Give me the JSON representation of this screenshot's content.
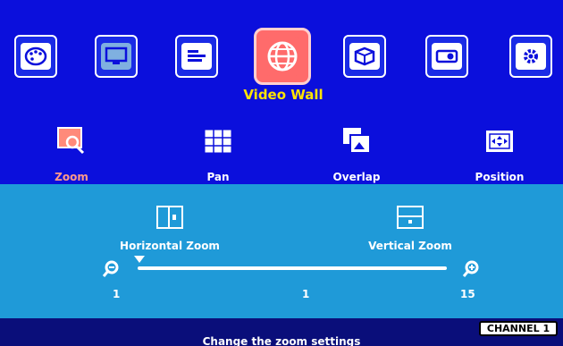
{
  "menu": {
    "items": [
      {
        "icon": "palette-icon",
        "active": false
      },
      {
        "icon": "monitor-icon",
        "active": false
      },
      {
        "icon": "bars-icon",
        "active": false
      },
      {
        "icon": "globe-icon",
        "active": true
      },
      {
        "icon": "cube-icon",
        "active": false
      },
      {
        "icon": "projector-icon",
        "active": false
      },
      {
        "icon": "gear-icon",
        "active": false
      }
    ],
    "active_title": "Video Wall"
  },
  "submenu": {
    "items": [
      {
        "label": "Zoom",
        "icon": "zoom-icon",
        "active": true
      },
      {
        "label": "Pan",
        "icon": "pan-grid-icon",
        "active": false
      },
      {
        "label": "Overlap",
        "icon": "overlap-icon",
        "active": false
      },
      {
        "label": "Position",
        "icon": "position-icon",
        "active": false
      }
    ]
  },
  "zoom_panel": {
    "horizontal_label": "Horizontal Zoom",
    "vertical_label": "Vertical Zoom",
    "slider": {
      "min": "1",
      "value": "1",
      "max": "15"
    }
  },
  "status": {
    "channel": "CHANNEL 1",
    "hint": "Change the zoom settings"
  },
  "colors": {
    "top_background": "#0b0fdc",
    "panel_background": "#1f9ad8",
    "title_text": "#ffe400",
    "active_accent": "#ff6b6b"
  }
}
